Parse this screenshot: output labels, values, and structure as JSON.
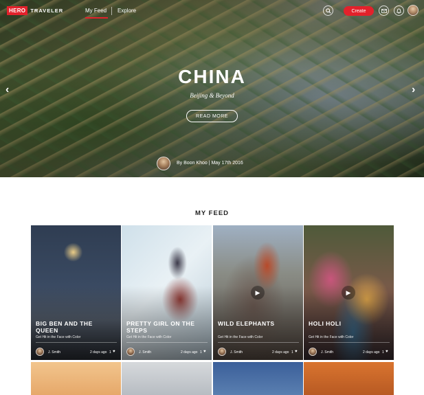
{
  "brand": {
    "logo_box": "HERO",
    "logo_text": "TRAVELER"
  },
  "nav": {
    "links": [
      {
        "label": "My Feed",
        "active": true
      },
      {
        "label": "Explore",
        "active": false
      }
    ],
    "create_label": "Create",
    "icons": [
      "search-icon",
      "mail-icon",
      "bell-icon",
      "avatar"
    ]
  },
  "hero": {
    "title": "CHINA",
    "subtitle": "Beijing & Beyond",
    "cta": "READ MORE",
    "byline": "By Boon Khoo | May 17th 2016"
  },
  "feed": {
    "heading": "MY FEED",
    "cards": [
      {
        "title": "BIG BEN AND THE QUEEN",
        "desc": "Get Hit in the Face with Color",
        "user": "J. Smith",
        "age": "2 days ago",
        "likes": "1",
        "video": false
      },
      {
        "title": "PRETTY GIRL ON THE STEPS",
        "desc": "Get Hit in the Face with Color",
        "user": "J. Smith",
        "age": "2 days ago",
        "likes": "1",
        "video": false
      },
      {
        "title": "WILD ELEPHANTS",
        "desc": "Get Hit in the Face with Color",
        "user": "J. Smith",
        "age": "2 days ago",
        "likes": "1",
        "video": true
      },
      {
        "title": "HOLI HOLI",
        "desc": "Get Hit in the Face with Color",
        "user": "J. Smith",
        "age": "2 days ago",
        "likes": "1",
        "video": true
      }
    ]
  },
  "colors": {
    "accent": "#e3212b",
    "text": "#222222"
  }
}
